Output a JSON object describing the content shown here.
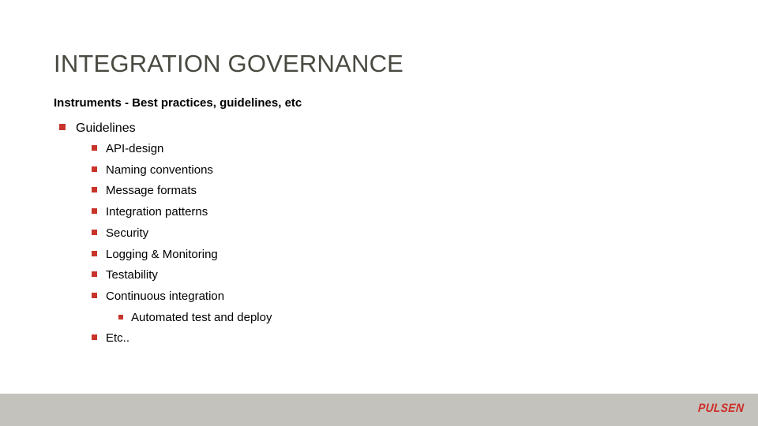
{
  "slide": {
    "title": "INTEGRATION GOVERNANCE",
    "subtitle": "Instruments - Best practices, guidelines, etc",
    "bullets": [
      {
        "level": 1,
        "label": "Guidelines"
      },
      {
        "level": 2,
        "label": "API-design"
      },
      {
        "level": 2,
        "label": "Naming conventions"
      },
      {
        "level": 2,
        "label": "Message formats"
      },
      {
        "level": 2,
        "label": "Integration patterns"
      },
      {
        "level": 2,
        "label": "Security"
      },
      {
        "level": 2,
        "label": "Logging & Monitoring"
      },
      {
        "level": 2,
        "label": "Testability"
      },
      {
        "level": 2,
        "label": "Continuous integration"
      },
      {
        "level": 3,
        "label": "Automated test and deploy"
      },
      {
        "level": 2,
        "label": "Etc.."
      }
    ]
  },
  "footer": {
    "logo_text": "PULSEN"
  },
  "colors": {
    "title": "#4a4a42",
    "bullet_marker": "#c8342a",
    "footer_bar": "#c3c2bc",
    "logo": "#cf2b26",
    "body_text": "#000000",
    "background": "#ffffff"
  }
}
